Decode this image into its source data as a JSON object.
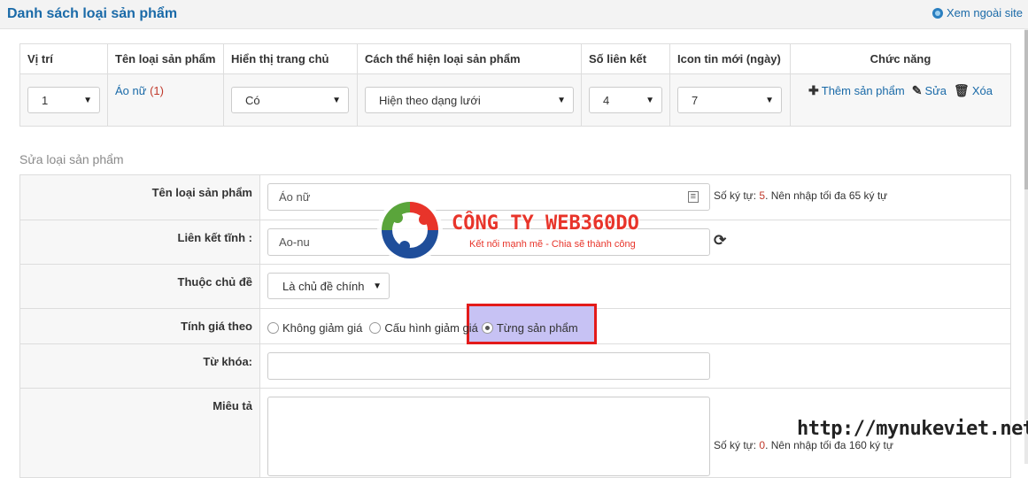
{
  "header": {
    "title": "Danh sách loại sản phẩm",
    "site_link": "Xem ngoài site"
  },
  "list_table": {
    "headers": [
      "Vị trí",
      "Tên loại sản phẩm",
      "Hiển thị trang chủ",
      "Cách thể hiện loại sản phẩm",
      "Số liên kết",
      "Icon tin mới (ngày)",
      "Chức năng"
    ],
    "row": {
      "position": "1",
      "name": "Áo nữ",
      "count": "(1)",
      "show_home": "Có",
      "display_mode": "Hiện theo dạng lưới",
      "num_links": "4",
      "new_icon_days": "7",
      "actions": {
        "add": "Thêm sản phẩm",
        "edit": "Sửa",
        "delete": "Xóa"
      }
    }
  },
  "form": {
    "section_title": "Sửa loại sản phẩm",
    "name": {
      "label": "Tên loại sản phẩm",
      "value": "Áo nữ",
      "hint_prefix": "Số ký tự:",
      "hint_count": "5",
      "hint_suffix": ". Nên nhập tối đa 65 ký tự"
    },
    "alias": {
      "label": "Liên kết tĩnh :",
      "value": "Ao-nu"
    },
    "topic": {
      "label": "Thuộc chủ đề",
      "value": "Là chủ đề chính"
    },
    "price": {
      "label": "Tính giá theo",
      "options": [
        "Không giảm giá",
        "Cấu hình giảm giá",
        "Từng sản phẩm"
      ],
      "selected": "Từng sản phẩm"
    },
    "keywords": {
      "label": "Từ khóa:",
      "value": ""
    },
    "description": {
      "label": "Miêu tả",
      "hint_prefix": "Số ký tự:",
      "hint_count": "0",
      "hint_suffix": ". Nên nhập tối đa 160 ký tự"
    }
  },
  "logo": {
    "company": "CÔNG TY WEB360DO",
    "slogan": "Kết nối mạnh mẽ - Chia sẽ thành công"
  },
  "watermark": "http://mynukeviet.net",
  "colors": {
    "link": "#1a6aa8",
    "highlight_border": "#e31b1b",
    "highlight_fill": "#c7c2f4",
    "logo_red": "#e8342a",
    "logo_blue": "#1f4e9a",
    "logo_green": "#5aa53b"
  }
}
